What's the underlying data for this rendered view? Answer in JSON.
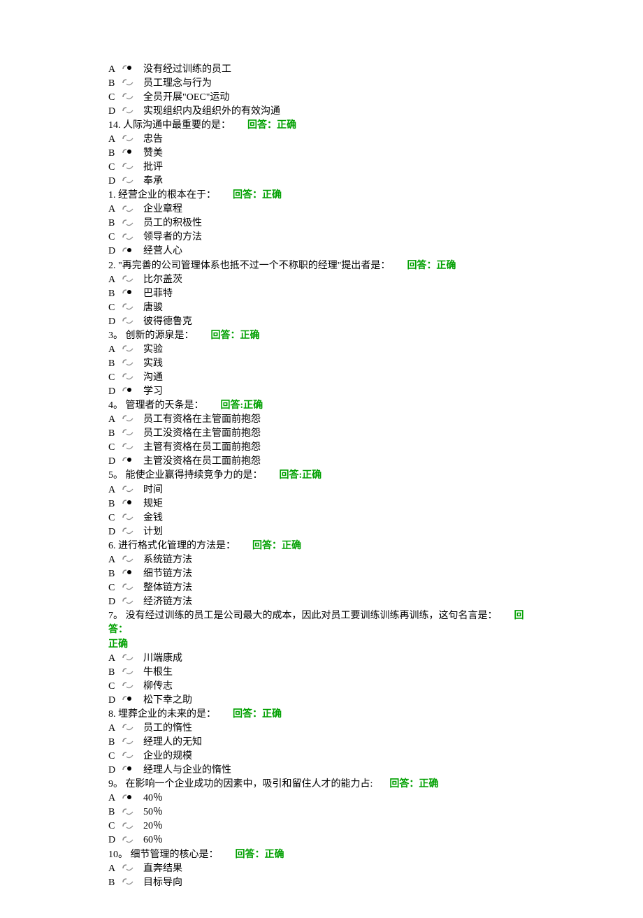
{
  "feedback_label": "回答：正确",
  "feedback_label_alt": "回答:正确",
  "questions": [
    {
      "num": null,
      "text": null,
      "feedback": null,
      "options": [
        {
          "letter": "A",
          "selected": true,
          "text": "没有经过训练的员工"
        },
        {
          "letter": "B",
          "selected": false,
          "text": "员工理念与行为"
        },
        {
          "letter": "C",
          "selected": false,
          "text": "全员开展\"OEC\"运动"
        },
        {
          "letter": "D",
          "selected": false,
          "text": "实现组织内及组织外的有效沟通"
        }
      ]
    },
    {
      "num": "14.",
      "text": "人际沟通中最重要的是：",
      "feedback": "回答：正确",
      "options": [
        {
          "letter": "A",
          "selected": false,
          "text": "忠告"
        },
        {
          "letter": "B",
          "selected": true,
          "text": "赞美"
        },
        {
          "letter": "C",
          "selected": false,
          "text": "批评"
        },
        {
          "letter": "D",
          "selected": false,
          "text": "奉承"
        }
      ]
    },
    {
      "num": "1.",
      "text": "经营企业的根本在于：",
      "feedback": "回答：正确",
      "options": [
        {
          "letter": "A",
          "selected": false,
          "text": "企业章程"
        },
        {
          "letter": "B",
          "selected": false,
          "text": "员工的积极性"
        },
        {
          "letter": "C",
          "selected": false,
          "text": "领导者的方法"
        },
        {
          "letter": "D",
          "selected": true,
          "text": "经营人心"
        }
      ]
    },
    {
      "num": "2.",
      "text": "\"再完善的公司管理体系也抵不过一个不称职的经理\"提出者是：",
      "feedback": "回答：正确",
      "options": [
        {
          "letter": "A",
          "selected": false,
          "text": "比尔盖茨"
        },
        {
          "letter": "B",
          "selected": true,
          "text": "巴菲特"
        },
        {
          "letter": "C",
          "selected": false,
          "text": "唐骏"
        },
        {
          "letter": "D",
          "selected": false,
          "text": "彼得德鲁克"
        }
      ]
    },
    {
      "num": "3。",
      "text": "创新的源泉是：",
      "feedback": "回答：正确",
      "options": [
        {
          "letter": "A",
          "selected": false,
          "text": "实验"
        },
        {
          "letter": "B",
          "selected": false,
          "text": "实践"
        },
        {
          "letter": "C",
          "selected": false,
          "text": "沟通"
        },
        {
          "letter": "D",
          "selected": true,
          "text": "学习"
        }
      ]
    },
    {
      "num": "4。",
      "text": "管理者的天条是：",
      "feedback": "回答:正确",
      "options": [
        {
          "letter": "A",
          "selected": false,
          "text": "员工有资格在主管面前抱怨"
        },
        {
          "letter": "B",
          "selected": false,
          "text": "员工没资格在主管面前抱怨"
        },
        {
          "letter": "C",
          "selected": false,
          "text": "主管有资格在员工面前抱怨"
        },
        {
          "letter": "D",
          "selected": true,
          "text": "主管没资格在员工面前抱怨"
        }
      ]
    },
    {
      "num": "5。",
      "text": "能使企业赢得持续竞争力的是：",
      "feedback": "回答:正确",
      "options": [
        {
          "letter": "A",
          "selected": false,
          "text": "时间"
        },
        {
          "letter": "B",
          "selected": true,
          "text": "规矩"
        },
        {
          "letter": "C",
          "selected": false,
          "text": "金钱"
        },
        {
          "letter": "D",
          "selected": false,
          "text": "计划"
        }
      ]
    },
    {
      "num": "6.",
      "text": "进行格式化管理的方法是：",
      "feedback": "回答：正确",
      "options": [
        {
          "letter": "A",
          "selected": false,
          "text": "系统链方法"
        },
        {
          "letter": "B",
          "selected": true,
          "text": "细节链方法"
        },
        {
          "letter": "C",
          "selected": false,
          "text": "整体链方法"
        },
        {
          "letter": "D",
          "selected": false,
          "text": "经济链方法"
        }
      ]
    },
    {
      "num": "7。",
      "text": "没有经过训练的员工是公司最大的成本，因此对员工要训练训练再训练，这句名言是：",
      "feedback_split": true,
      "feedback_a": "回答：",
      "feedback_b": "正确",
      "options": [
        {
          "letter": "A",
          "selected": false,
          "text": "川端康成"
        },
        {
          "letter": "B",
          "selected": false,
          "text": "牛根生"
        },
        {
          "letter": "C",
          "selected": false,
          "text": "柳传志"
        },
        {
          "letter": "D",
          "selected": true,
          "text": "松下幸之助"
        }
      ]
    },
    {
      "num": "8.",
      "text": "埋葬企业的未来的是：",
      "feedback": "回答：正确",
      "options": [
        {
          "letter": "A",
          "selected": false,
          "text": "员工的惰性"
        },
        {
          "letter": "B",
          "selected": false,
          "text": "经理人的无知"
        },
        {
          "letter": "C",
          "selected": false,
          "text": "企业的规模"
        },
        {
          "letter": "D",
          "selected": true,
          "text": "经理人与企业的惰性"
        }
      ]
    },
    {
      "num": "9。",
      "text": "在影响一个企业成功的因素中，吸引和留住人才的能力占:",
      "feedback": "回答：正确",
      "options": [
        {
          "letter": "A",
          "selected": true,
          "text": "40％"
        },
        {
          "letter": "B",
          "selected": false,
          "text": "50％"
        },
        {
          "letter": "C",
          "selected": false,
          "text": "20％"
        },
        {
          "letter": "D",
          "selected": false,
          "text": "60％"
        }
      ]
    },
    {
      "num": "10。",
      "text": "细节管理的核心是：",
      "feedback": "回答：正确",
      "options": [
        {
          "letter": "A",
          "selected": false,
          "text": "直奔结果"
        },
        {
          "letter": "B",
          "selected": false,
          "text": "目标导向"
        }
      ]
    }
  ]
}
